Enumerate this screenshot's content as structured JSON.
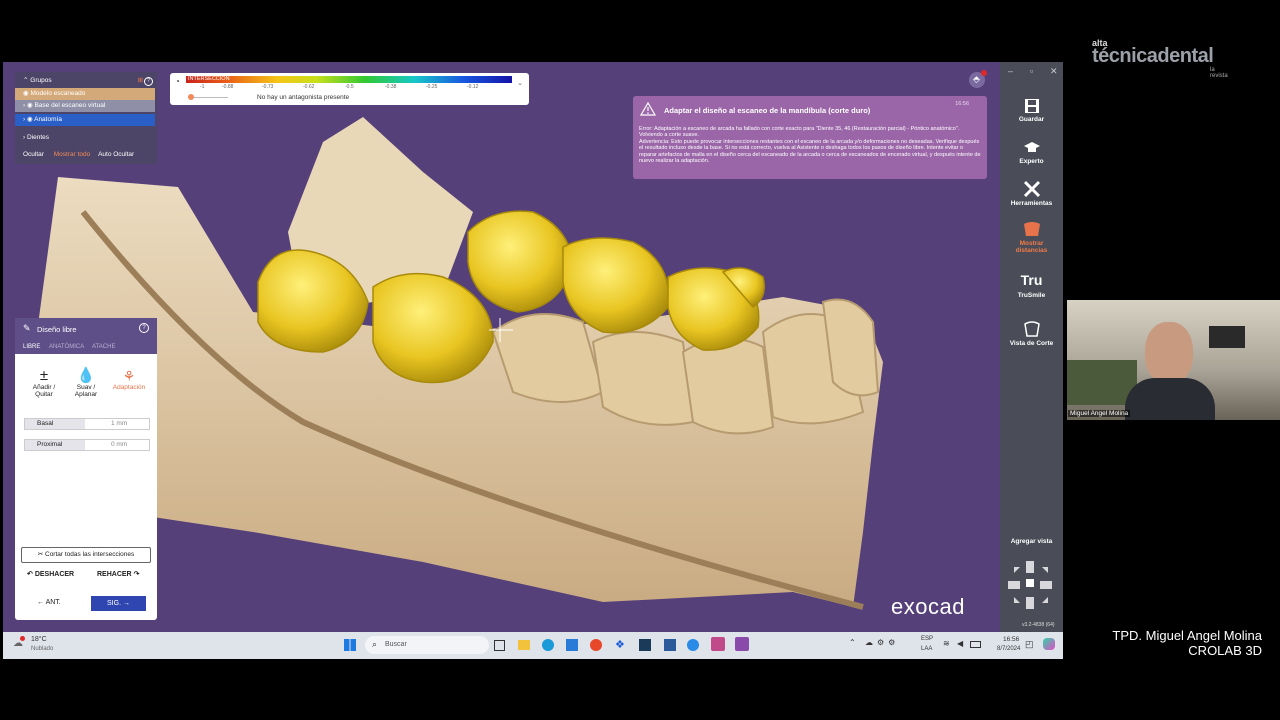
{
  "brand": {
    "top": "alta",
    "name": "técnicadental",
    "sub": "la revista"
  },
  "groups_panel": {
    "title": "Grupos",
    "items": [
      "Modelo escaneado",
      "Base del escaneo virtual",
      "Anatomía",
      "Dientes"
    ],
    "hide_label": "Ocultar",
    "show_all": "Mostrar todo",
    "auto_hide": "Auto Ocultar"
  },
  "legend": {
    "label": "INTERSECCIÓN",
    "ticks": [
      "-1",
      "-0.88",
      "-0.73",
      "-0.62",
      "-0.5",
      "-0.38",
      "-0.25",
      "-0.12"
    ],
    "status": "No hay un antagonista presente"
  },
  "notification": {
    "title": "Adaptar el diseño al escaneo de la mandíbula (corte duro)",
    "time": "16:56",
    "body1": "Error: Adaptación a escaneo de arcada ha fallado con corte exacto para \"Diente 35, 46 (Restauración parcial) - Póntico anatómico\". Volviendo a corte suave.",
    "body2": "Advertencia: Esto puede provocar intersecciones restantes con el escaneo de la arcada y/o deformaciones no deseadas. Verifique después el resultado incluso desde la base. Si no está correcto, vuelva al Asistente o deshaga todos los pasos de diseño libre. Intente evitar o reparar artefactos de malla en el diseño cerca del escaneado de la arcada o cerca de escaneados de encerado virtual, y después intente de nuevo realizar la adaptación."
  },
  "toolbar": {
    "save": "Guardar",
    "expert": "Experto",
    "tools": "Herramientas",
    "show_dist_1": "Mostrar",
    "show_dist_2": "distancias",
    "trusmile_icon": "Tru",
    "trusmile": "TruSmile",
    "cut_view": "Vista de Corte",
    "add_view": "Agregar vista"
  },
  "freeform": {
    "title": "Diseño libre",
    "tabs": [
      "LIBRE",
      "ANATÓMICA",
      "ATACHE"
    ],
    "tools": [
      "Añadir / Quitar",
      "Suav / Aplanar",
      "Adaptación"
    ],
    "fields": [
      {
        "label": "Basal",
        "value": "1 mm"
      },
      {
        "label": "Proximal",
        "value": "0 mm"
      }
    ],
    "cut_intersections": "Cortar todas las intersecciones",
    "undo": "DESHACER",
    "redo": "REHACER",
    "prev": "ANT.",
    "next": "SIG."
  },
  "exocad": {
    "logo": "exocad",
    "version": "v3.2-4838 (64)"
  },
  "taskbar": {
    "weather_temp": "18°C",
    "weather_desc": "Nublado",
    "search": "Buscar",
    "lang1": "ESP",
    "lang2": "LAA",
    "time": "16:56",
    "date": "8/7/2024"
  },
  "camera": {
    "name": "Miguel Angel Molina"
  },
  "footer": {
    "line1": "TPD. Miguel Angel Molina",
    "line2": "CROLAB 3D"
  }
}
